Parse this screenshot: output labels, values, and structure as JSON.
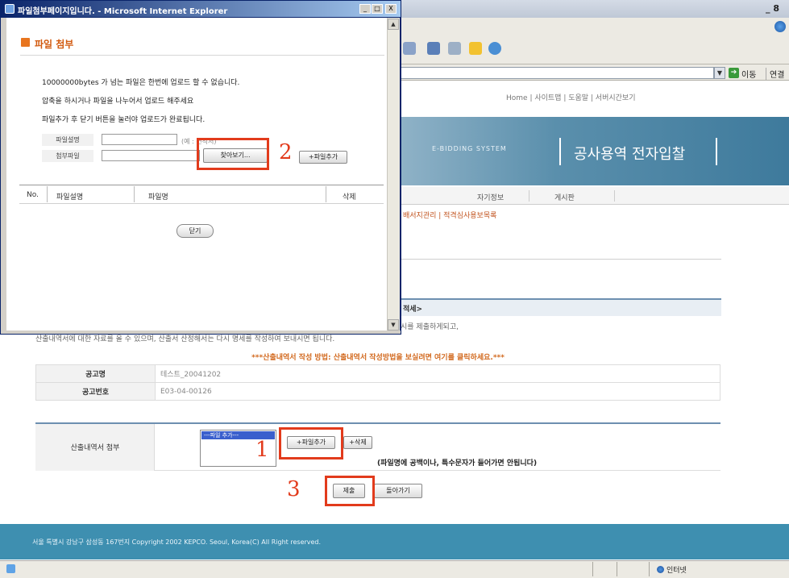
{
  "popup": {
    "title": "파일첨부페이지입니다. - Microsoft Internet Explorer",
    "controls": [
      "_",
      "□",
      "X"
    ],
    "heading": "파일 첨부",
    "lines": [
      "10000000bytes 가 넘는 파일은 한번에 업로드 할 수 없습니다.",
      "압축을 하시거나 파일을 나누어서 업로드 해주세요",
      "파일추가 후 닫기 버튼을 눌러야 업로드가 완료됩니다."
    ],
    "file_desc_label": "파일설명",
    "file_desc_example": "(예 : 견적서)",
    "attach_label": "첨부파일",
    "browse_button": "찾아보기...",
    "add_file_button": "+파일추가",
    "table_headers": [
      "No.",
      "파일설명",
      "파일명",
      "삭제"
    ],
    "close_button": "닫기"
  },
  "browser": {
    "go_label": "이동",
    "links_label": "연결",
    "status_zone": "인터넷"
  },
  "page": {
    "top_links": "Home  |  사이트맵  |  도움말  |  서버시간보기",
    "banner_sub": "E-BIDDING SYSTEM",
    "banner_title": "공사용역 전자입찰",
    "nav_items": [
      "자기정보",
      "게시판"
    ],
    "sub_nav": "배서지관리 | 적격심사용보목록",
    "section_header": "적세>",
    "notice_line1": "시를 제출하게되고,",
    "notice_line2": "산출내역서에 대한 자료를 올 수 있으며, 산출서 산정해서는 다시 명세를 작성하여 보내시면 됩니다.",
    "notice_line2_right": "기계 작성하여 보내시면 됩니다.",
    "guide": "***산출내역서 작성 방법: 산출내역서 작성방법을 보실려면 여기를 클릭하세요.***",
    "info_rows": [
      {
        "label": "공고명",
        "value": "테스트_20041202"
      },
      {
        "label": "공고번호",
        "value": "E03-04-00126"
      }
    ],
    "attach_label": "산출내역서 첨부",
    "attach_list_item": "---파일 추가---",
    "add_file_button": "+파일추가",
    "delete_button": "+삭제",
    "attach_warning": "(파일명에 공백이나, 특수문자가 들어가면 안됩니다)",
    "submit_button": "제출",
    "back_button": "돌아가기",
    "footer": "서울 특별시 강남구 삼성동 167번지  Copyright 2002 KEPCO. Seoul, Korea(C) All Right reserved."
  },
  "markers": {
    "one": "1",
    "two": "2",
    "three": "3"
  }
}
